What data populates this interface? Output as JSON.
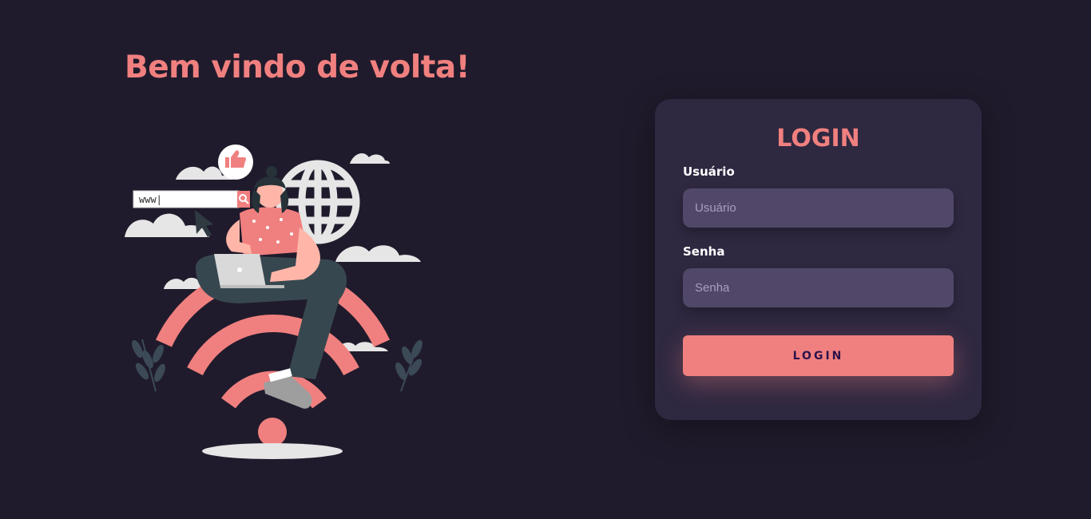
{
  "header": {
    "welcome_title": "Bem vindo de volta!"
  },
  "illustration": {
    "search_text": "www|",
    "icons": [
      "thumbs-up-icon",
      "globe-icon",
      "search-icon",
      "cursor-icon",
      "laptop-icon",
      "wifi-icon"
    ]
  },
  "login": {
    "title": "LOGIN",
    "username_label": "Usuário",
    "username_placeholder": "Usuário",
    "username_value": "",
    "password_label": "Senha",
    "password_placeholder": "Senha",
    "password_value": "",
    "submit_label": "LOGIN"
  },
  "colors": {
    "background": "#201b2c",
    "accent": "#f0807f",
    "card": "#2f2841",
    "input": "#514869",
    "button_text": "#2b134b"
  }
}
